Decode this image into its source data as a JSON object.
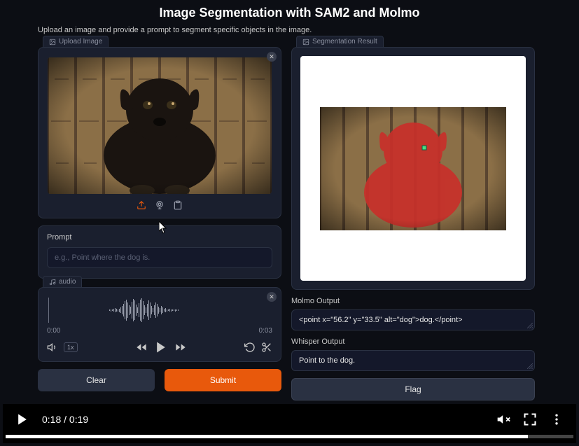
{
  "title": "Image Segmentation with SAM2 and Molmo",
  "subtitle": "Upload an image and provide a prompt to segment specific objects in the image.",
  "upload": {
    "tab": "Upload Image",
    "icon": "image-icon"
  },
  "prompt": {
    "label": "Prompt",
    "placeholder": "e.g., Point where the dog is."
  },
  "audio": {
    "tab": "audio",
    "time_start": "0:00",
    "time_end": "0:03",
    "speed": "1x"
  },
  "buttons": {
    "clear": "Clear",
    "submit": "Submit",
    "flag": "Flag"
  },
  "result": {
    "tab": "Segmentation Result",
    "molmo_label": "Molmo Output",
    "molmo_value": "<point x=\"56.2\" y=\"33.5\" alt=\"dog\">dog.</point>",
    "whisper_label": "Whisper Output",
    "whisper_value": "Point to the dog."
  },
  "video": {
    "time": "0:18 / 0:19"
  }
}
